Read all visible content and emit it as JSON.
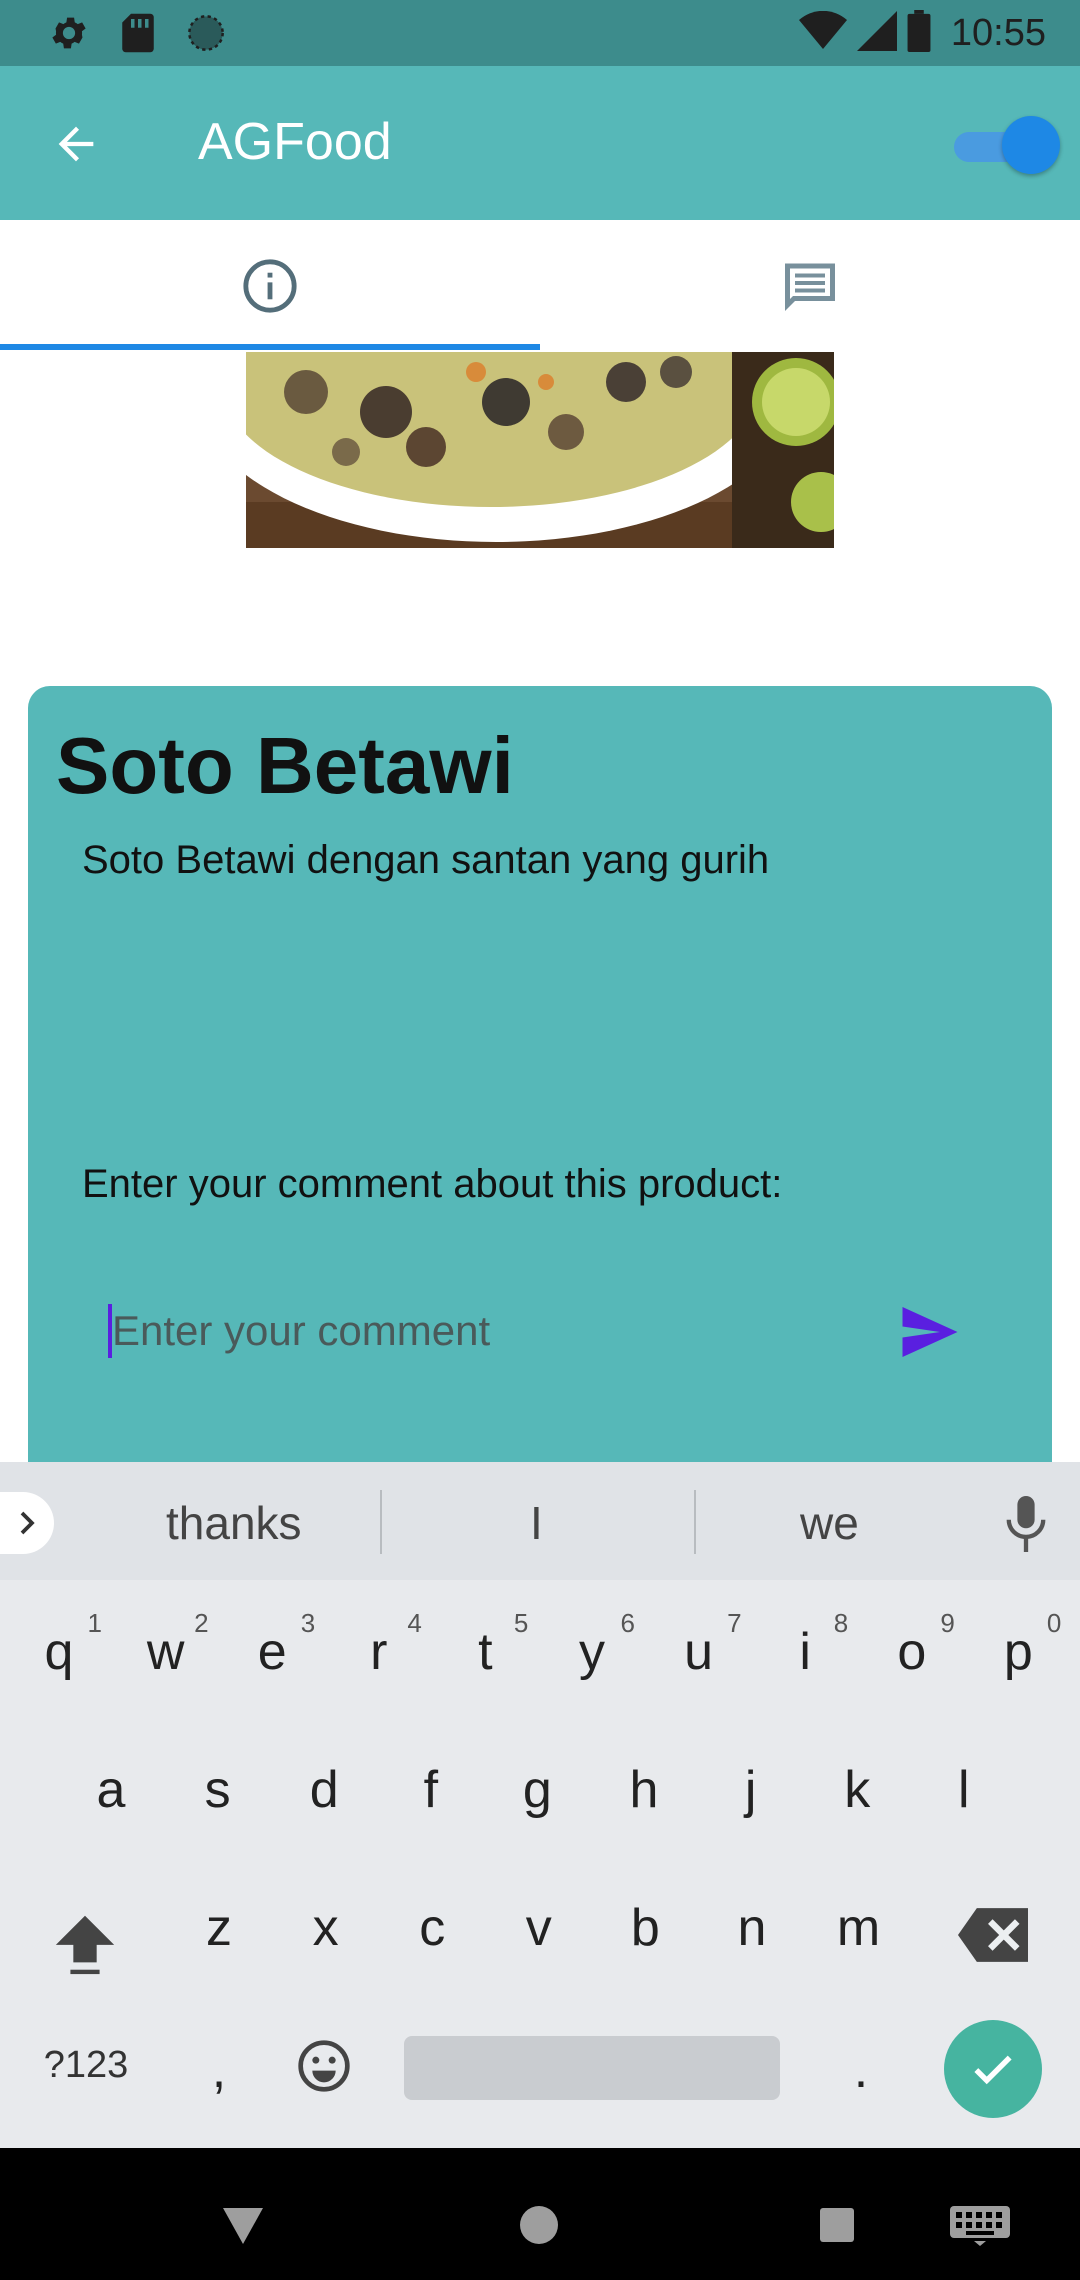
{
  "status_bar": {
    "time": "10:55",
    "left_icons": [
      "settings-icon",
      "sd-card-icon",
      "circle-icon"
    ],
    "right_icons": [
      "wifi-icon",
      "signal-icon",
      "battery-icon"
    ]
  },
  "app_bar": {
    "title": "AGFood",
    "toggle_on": true
  },
  "tabs": [
    {
      "icon": "info-icon",
      "selected": true
    },
    {
      "icon": "comment-icon",
      "selected": false
    }
  ],
  "product": {
    "name": "Soto Betawi",
    "description": "Soto Betawi dengan santan yang gurih",
    "comment_prompt": "Enter your comment about this product:",
    "comment_placeholder": "Enter your comment"
  },
  "keyboard": {
    "suggestions": [
      "thanks",
      "I",
      "we"
    ],
    "row1": [
      {
        "k": "q",
        "n": "1"
      },
      {
        "k": "w",
        "n": "2"
      },
      {
        "k": "e",
        "n": "3"
      },
      {
        "k": "r",
        "n": "4"
      },
      {
        "k": "t",
        "n": "5"
      },
      {
        "k": "y",
        "n": "6"
      },
      {
        "k": "u",
        "n": "7"
      },
      {
        "k": "i",
        "n": "8"
      },
      {
        "k": "o",
        "n": "9"
      },
      {
        "k": "p",
        "n": "0"
      }
    ],
    "row2": [
      "a",
      "s",
      "d",
      "f",
      "g",
      "h",
      "j",
      "k",
      "l"
    ],
    "row3": [
      "z",
      "x",
      "c",
      "v",
      "b",
      "n",
      "m"
    ],
    "symbols_label": "?123",
    "comma": ",",
    "period": "."
  },
  "colors": {
    "status_bar": "#3d8c8c",
    "app_bar": "#56b8b8",
    "card": "#56b8b8",
    "accent": "#1e88e5",
    "send": "#5a1fe0"
  }
}
